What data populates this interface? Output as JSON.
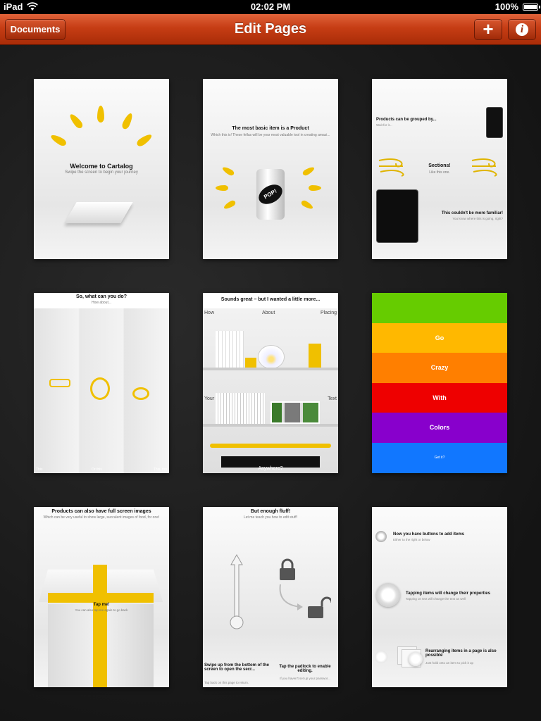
{
  "status": {
    "device": "iPad",
    "time": "02:02 PM",
    "battery": "100%"
  },
  "navbar": {
    "title": "Edit Pages",
    "documents_label": "Documents",
    "add_label": "+",
    "info_label": "i"
  },
  "pages": {
    "p1": {
      "title": "Welcome to Cartalog",
      "subtitle": "Swipe the screen to begin your journey"
    },
    "p2": {
      "title": "The most basic item is a Product",
      "subtitle": "Which this is! These fellas will be your most valuable tool in creating amazi...",
      "can_text": "POP!"
    },
    "p3": {
      "grouped": "Products can be grouped by...",
      "grouped_sub": "Wait for it...",
      "sections": "Sections!",
      "sections_sub": "Like this one.",
      "familiar": "This couldn't be more familiar!",
      "familiar_sub": "You know where this is going, right?"
    },
    "p4": {
      "title": "So, what can you do?",
      "subtitle": "How about...",
      "l1": "This",
      "l2": "Or this",
      "l3": "This, too"
    },
    "p5": {
      "title": "Sounds great – but I wanted a little more...",
      "how": "How",
      "about": "About",
      "placing": "Placing",
      "your": "Your",
      "text": "Text",
      "anywhere": "Anywhere?"
    },
    "p6": {
      "b2": "Go",
      "b3": "Crazy",
      "b4": "With",
      "b5": "Colors",
      "b6": "Get it?"
    },
    "p7": {
      "title": "Products can also have full screen images",
      "subtitle": "Which can be very useful to show large, succulent images of food, for one!",
      "tap": "Tap me!",
      "tap_sub": "You can also tap me again to go back"
    },
    "p8": {
      "title": "But enough fluff!",
      "subtitle": "Let me teach you how to edit stuff!",
      "swipe": "Swipe up from the bottom of the screen to open the secr...",
      "swipe_sub": "Tap back on this page to return.",
      "padlock": "Tap the padlock to enable editing.",
      "padlock_sub": "If you haven't set up your passwor..."
    },
    "p9": {
      "buttons": "Now you have buttons to add items",
      "buttons_sub": "Either to the right or below",
      "tapping": "Tapping items will change their properties",
      "tapping_sub": "Tapping on text will change the text as well",
      "rearranging": "Rearranging items in a page is also possible",
      "rearranging_sub": "Just hold onto an item to pick it up"
    }
  },
  "colors": {
    "nav": "#c63d14",
    "green": "#66cc00",
    "yellow": "#ffb800",
    "orange": "#ff7f00",
    "red": "#ee0000",
    "purple": "#8800cc",
    "blue": "#1177ff",
    "accent_yellow": "#f0c000"
  }
}
